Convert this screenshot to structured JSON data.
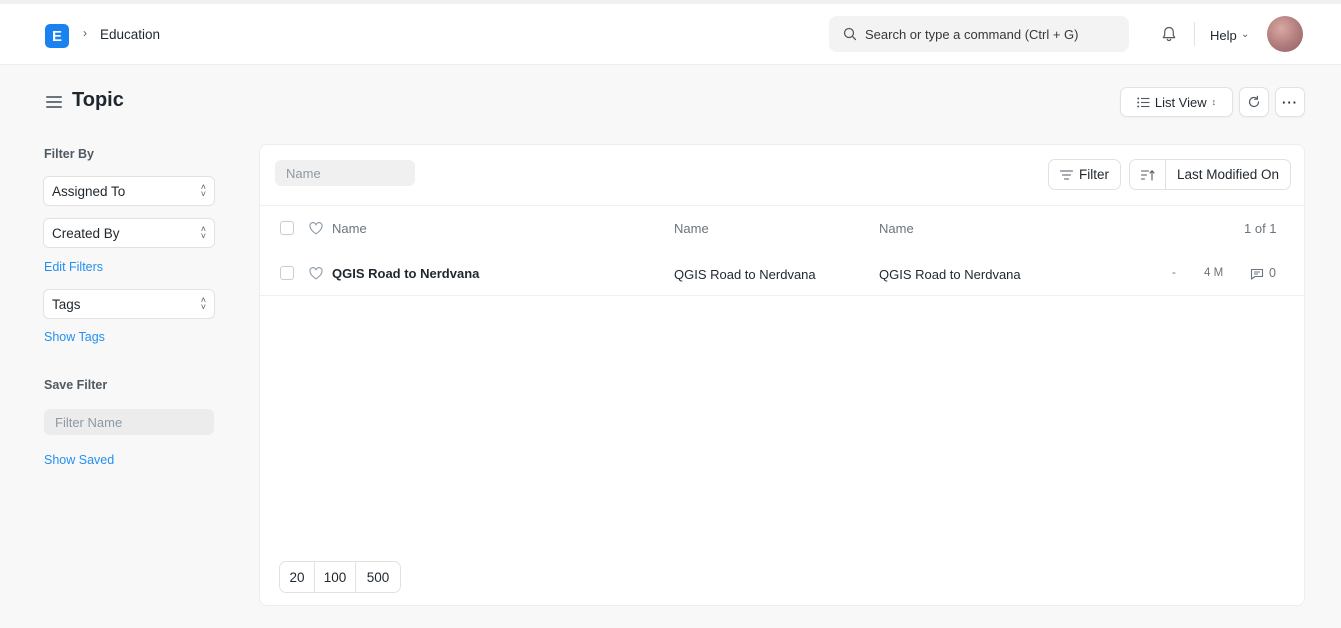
{
  "navbar": {
    "logo_letter": "E",
    "breadcrumb": "Education",
    "search_placeholder": "Search or type a command (Ctrl + G)",
    "help_label": "Help"
  },
  "page": {
    "title": "Topic",
    "view_label": "List View",
    "more_label": "···"
  },
  "sidebar": {
    "filter_by_label": "Filter By",
    "assigned_to": "Assigned To",
    "created_by": "Created By",
    "edit_filters": "Edit Filters",
    "tags": "Tags",
    "show_tags": "Show Tags",
    "save_filter_label": "Save Filter",
    "filter_name_placeholder": "Filter Name",
    "show_saved": "Show Saved"
  },
  "list": {
    "name_placeholder": "Name",
    "filter_label": "Filter",
    "sort_label": "Last Modified On",
    "headers": [
      "Name",
      "Name",
      "Name"
    ],
    "count": "1 of 1",
    "rows": [
      {
        "title": "QGIS Road to Nerdvana",
        "col2": "QGIS Road to Nerdvana",
        "col3": "QGIS Road to Nerdvana",
        "dash": "-",
        "modified": "4 M",
        "comments": "0"
      }
    ],
    "page_sizes": [
      "20",
      "100",
      "500"
    ]
  },
  "colors": {
    "accent": "#2490ef",
    "logo": "#1a81f0"
  }
}
